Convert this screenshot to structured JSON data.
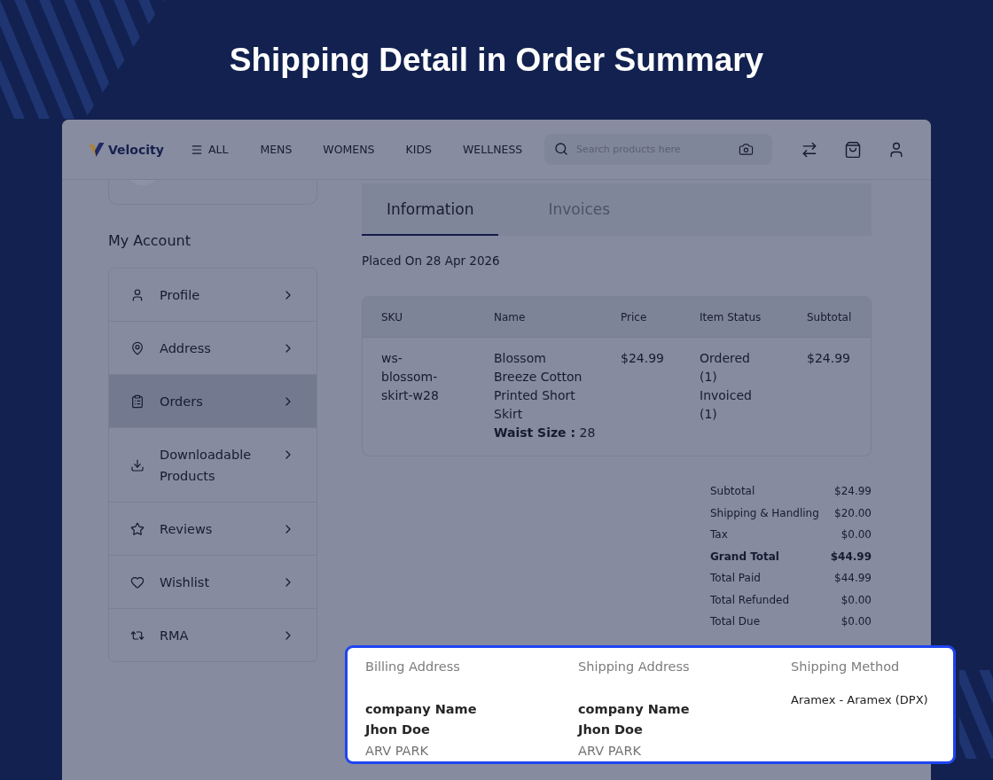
{
  "title": "Shipping Detail in Order Summary",
  "header": {
    "logo": "Velocity",
    "menu": "ALL",
    "nav": [
      "MENS",
      "WOMENS",
      "KIDS",
      "WELLNESS"
    ],
    "search": {
      "placeholder": "Search products here"
    }
  },
  "sidebar": {
    "heading": "My Account",
    "items": [
      {
        "label": "Profile",
        "selected": false
      },
      {
        "label": "Address",
        "selected": false
      },
      {
        "label": "Orders",
        "selected": true
      },
      {
        "label": "Downloadable Products",
        "selected": false
      },
      {
        "label": "Reviews",
        "selected": false
      },
      {
        "label": "Wishlist",
        "selected": false
      },
      {
        "label": "RMA",
        "selected": false
      }
    ]
  },
  "tabs": [
    {
      "label": "Information",
      "selected": true
    },
    {
      "label": "Invoices",
      "selected": false
    }
  ],
  "placed_on": "Placed On 28 Apr 2026",
  "table": {
    "columns": [
      "SKU",
      "Name",
      "Price",
      "Item Status",
      "Subtotal"
    ],
    "rows": [
      {
        "sku": "ws-blossom-skirt-w28",
        "name": "Blossom Breeze Cotton Printed Short Skirt",
        "option": "**Waist Size :** 28",
        "price": "$24.99",
        "status": [
          "Ordered (1)",
          "Invoiced (1)"
        ],
        "subtotal": "$24.99"
      }
    ]
  },
  "totals": [
    {
      "label": "Subtotal",
      "value": "$24.99",
      "kind": "line"
    },
    {
      "label": "Shipping & Handling",
      "value": "$20.00",
      "kind": "line"
    },
    {
      "label": "Tax",
      "value": "$0.00",
      "kind": "line"
    },
    {
      "label": "Grand Total",
      "value": "$44.99",
      "kind": "grand_total"
    },
    {
      "label": "Total Paid",
      "value": "$44.99",
      "kind": "line"
    },
    {
      "label": "Total Refunded",
      "value": "$0.00",
      "kind": "line"
    },
    {
      "label": "Total Due",
      "value": "$0.00",
      "kind": "line"
    }
  ],
  "address_panel": {
    "highlighted": true,
    "addresses": [
      {
        "heading": "Billing Address",
        "company": "company Name",
        "name": "Jhon Doe",
        "street": "ARV PARK"
      },
      {
        "heading": "Shipping Address",
        "company": "company Name",
        "name": "Jhon Doe",
        "street": "ARV PARK"
      }
    ],
    "shipping_method": {
      "heading": "Shipping Method",
      "value": "Aramex - Aramex (DPX)"
    }
  }
}
